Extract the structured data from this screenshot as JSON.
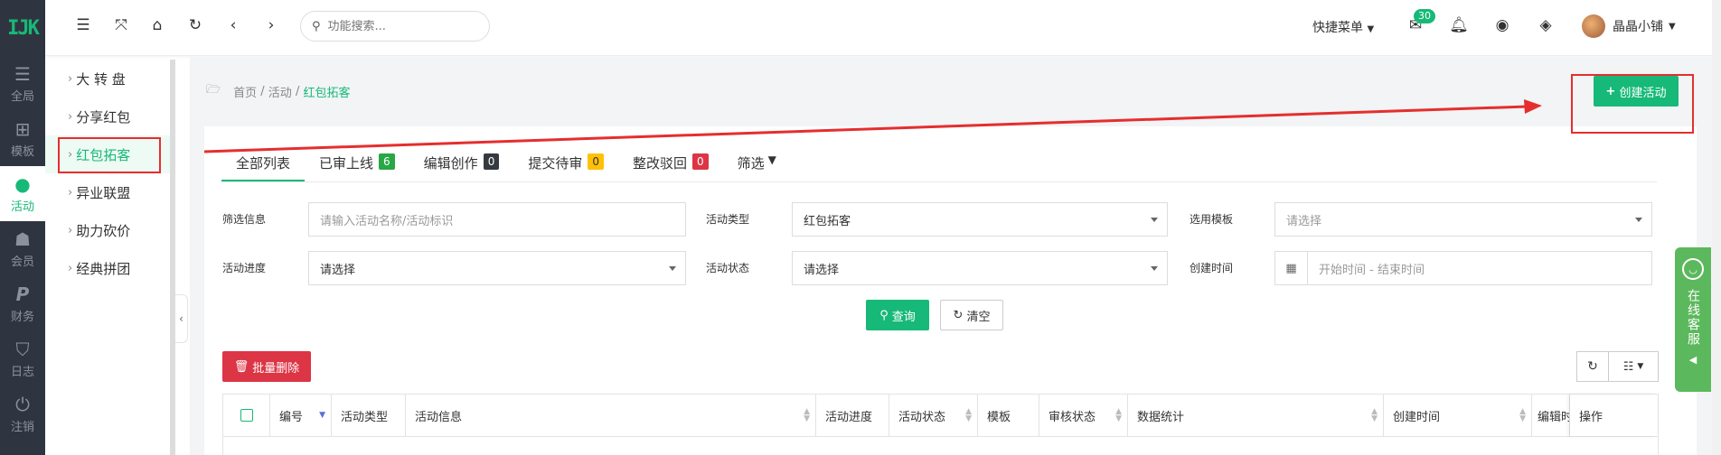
{
  "logo": "IJK",
  "rail": [
    {
      "icon": "sliders-icon",
      "glyph": "⚙",
      "label": "全局"
    },
    {
      "icon": "sitemap-icon",
      "glyph": "⊞",
      "label": "模板"
    },
    {
      "icon": "map-pin-icon",
      "glyph": "⚲",
      "label": "活动"
    },
    {
      "icon": "users-icon",
      "glyph": "☗",
      "label": "会员"
    },
    {
      "icon": "paypal-icon",
      "glyph": "P",
      "label": "财务"
    },
    {
      "icon": "shield-icon",
      "glyph": "⛉",
      "label": "日志"
    },
    {
      "icon": "power-icon",
      "glyph": "⏻",
      "label": "注销"
    }
  ],
  "submenu": [
    "大 转 盘",
    "分享红包",
    "红包拓客",
    "异业联盟",
    "助力砍价",
    "经典拼团"
  ],
  "topbar": {
    "search_placeholder": "功能搜索...",
    "quick_menu": "快捷菜单",
    "mail_badge": "30",
    "user_name": "晶晶小铺"
  },
  "breadcrumb": {
    "home": "首页",
    "activity": "活动",
    "current": "红包拓客"
  },
  "create_button": "创建活动",
  "tabs": [
    {
      "label": "全部列表",
      "count": "",
      "color": ""
    },
    {
      "label": "已审上线",
      "count": "6",
      "color": "#28a745"
    },
    {
      "label": "编辑创作",
      "count": "0",
      "color": "#343a40"
    },
    {
      "label": "提交待审",
      "count": "0",
      "color": "#ffc107"
    },
    {
      "label": "整改驳回",
      "count": "0",
      "color": "#dc3545"
    },
    {
      "label": "筛选",
      "count": "",
      "color": ""
    }
  ],
  "filters": {
    "info_label": "筛选信息",
    "info_placeholder": "请输入活动名称/活动标识",
    "type_label": "活动类型",
    "type_value": "红包拓客",
    "template_label": "选用模板",
    "template_placeholder": "请选择",
    "progress_label": "活动进度",
    "progress_value": "请选择",
    "status_label": "活动状态",
    "status_value": "请选择",
    "created_label": "创建时间",
    "created_placeholder": "开始时间 - 结束时间"
  },
  "buttons": {
    "query": "查询",
    "clear": "清空",
    "batch_delete": "批量删除"
  },
  "columns": [
    "编号",
    "活动类型",
    "活动信息",
    "活动进度",
    "活动状态",
    "模板",
    "审核状态",
    "数据统计",
    "创建时间",
    "编辑时",
    "操作"
  ],
  "service": "在线客服"
}
